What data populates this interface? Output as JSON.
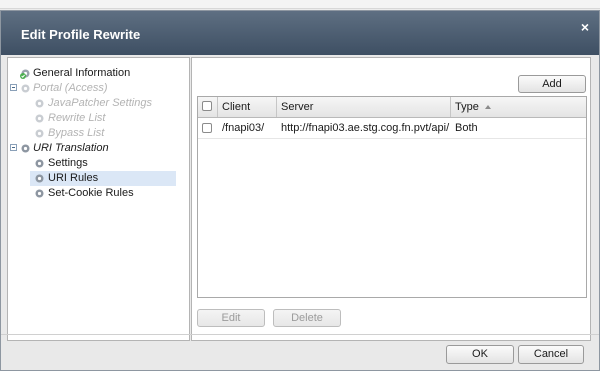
{
  "dialog": {
    "title": "Edit Profile Rewrite",
    "close_glyph": "×"
  },
  "tree": {
    "items": [
      {
        "label": "General Information",
        "icon": "check-gear-icon",
        "state": "normal"
      },
      {
        "label": "Portal (Access)",
        "icon": "folder-gear-icon",
        "state": "disabled"
      },
      {
        "label": "JavaPatcher Settings",
        "icon": "gear-icon",
        "state": "disabled"
      },
      {
        "label": "Rewrite List",
        "icon": "gear-icon",
        "state": "disabled"
      },
      {
        "label": "Bypass List",
        "icon": "gear-icon",
        "state": "disabled"
      },
      {
        "label": "URI Translation",
        "icon": "folder-gear-icon",
        "state": "italic"
      },
      {
        "label": "Settings",
        "icon": "gear-icon",
        "state": "normal"
      },
      {
        "label": "URI Rules",
        "icon": "gear-icon",
        "state": "selected"
      },
      {
        "label": "Set-Cookie Rules",
        "icon": "gear-icon",
        "state": "normal"
      }
    ]
  },
  "grid": {
    "add_label": "Add",
    "columns": [
      "Client",
      "Server",
      "Type"
    ],
    "rows": [
      {
        "client": "/fnapi03/",
        "server": "http://fnapi03.ae.stg.cog.fn.pvt/api/",
        "type": "Both"
      }
    ],
    "edit_label": "Edit",
    "delete_label": "Delete"
  },
  "footer": {
    "ok_label": "OK",
    "cancel_label": "Cancel"
  },
  "colors": {
    "titlebar": "#4b5c70",
    "selection": "#dbe7f6"
  }
}
